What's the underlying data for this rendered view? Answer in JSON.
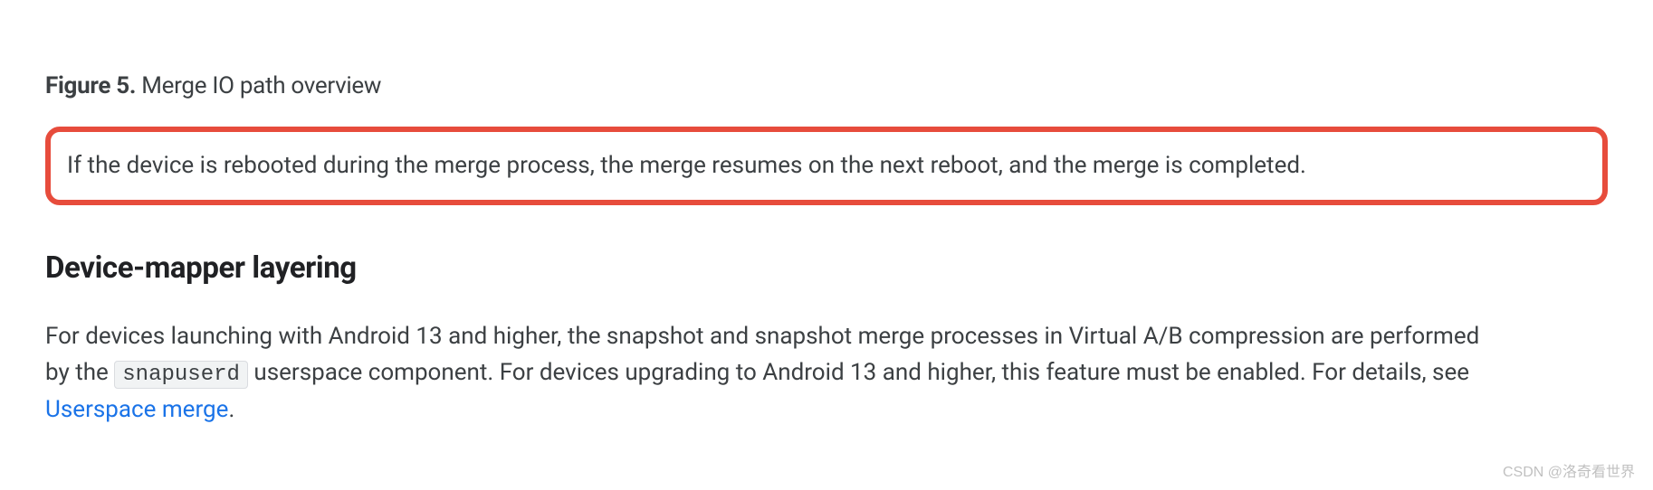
{
  "figure": {
    "label": "Figure 5.",
    "caption": " Merge IO path overview"
  },
  "highlighted_text": "If the device is rebooted during the merge process, the merge resumes on the next reboot, and the merge is completed.",
  "section_heading": "Device-mapper layering",
  "paragraph": {
    "part1": "For devices launching with Android 13 and higher, the snapshot and snapshot merge processes in Virtual A/B compression are performed by the ",
    "code": "snapuserd",
    "part2": " userspace component. For devices upgrading to Android 13 and higher, this feature must be enabled. For details, see ",
    "link_text": "Userspace merge",
    "part3": "."
  },
  "watermark": "CSDN @洛奇看世界"
}
